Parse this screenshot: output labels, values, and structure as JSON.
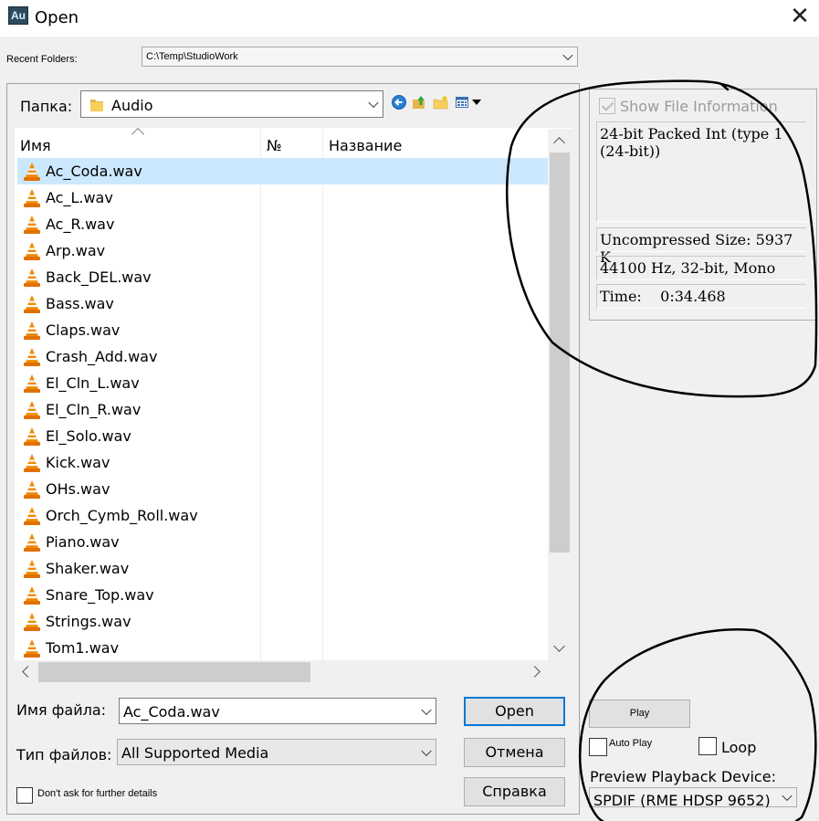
{
  "window": {
    "app_icon_text": "Au",
    "title": "Open",
    "close_glyph": "✕"
  },
  "recent": {
    "label": "Recent Folders:",
    "value": "C:\\Temp\\StudioWork"
  },
  "folder": {
    "label": "Папка:",
    "value": "Audio"
  },
  "columns": {
    "name": "Имя",
    "number": "№",
    "title": "Название"
  },
  "files": [
    {
      "name": "Ac_Coda.wav",
      "selected": true
    },
    {
      "name": "Ac_L.wav"
    },
    {
      "name": "Ac_R.wav"
    },
    {
      "name": "Arp.wav"
    },
    {
      "name": "Back_DEL.wav"
    },
    {
      "name": "Bass.wav"
    },
    {
      "name": "Claps.wav"
    },
    {
      "name": "Crash_Add.wav"
    },
    {
      "name": "El_Cln_L.wav"
    },
    {
      "name": "El_Cln_R.wav"
    },
    {
      "name": "El_Solo.wav"
    },
    {
      "name": "Kick.wav"
    },
    {
      "name": "OHs.wav"
    },
    {
      "name": "Orch_Cymb_Roll.wav"
    },
    {
      "name": "Piano.wav"
    },
    {
      "name": "Shaker.wav"
    },
    {
      "name": "Snare_Top.wav"
    },
    {
      "name": "Strings.wav"
    },
    {
      "name": "Tom1.wav"
    }
  ],
  "filename": {
    "label": "Имя файла:",
    "value": "Ac_Coda.wav"
  },
  "filetype": {
    "label": "Тип файлов:",
    "value": "All Supported Media"
  },
  "buttons": {
    "open": "Open",
    "cancel": "Отмена",
    "help": "Справка",
    "play": "Play"
  },
  "dont_ask": "Don't ask for further details",
  "info": {
    "show_label": "Show File Information",
    "format": "24-bit Packed Int (type 1\n(24-bit))",
    "size": "Uncompressed Size: 5937 K",
    "rate": "44100 Hz, 32-bit, Mono",
    "time": "Time:    0:34.468"
  },
  "playback": {
    "auto_play": "Auto Play",
    "loop": "Loop",
    "device_label": "Preview Playback Device:",
    "device_value": "SPDIF (RME HDSP 9652)"
  },
  "colors": {
    "selection": "#cce8ff",
    "primary_border": "#0078d7",
    "vlc_orange": "#f08a00"
  }
}
